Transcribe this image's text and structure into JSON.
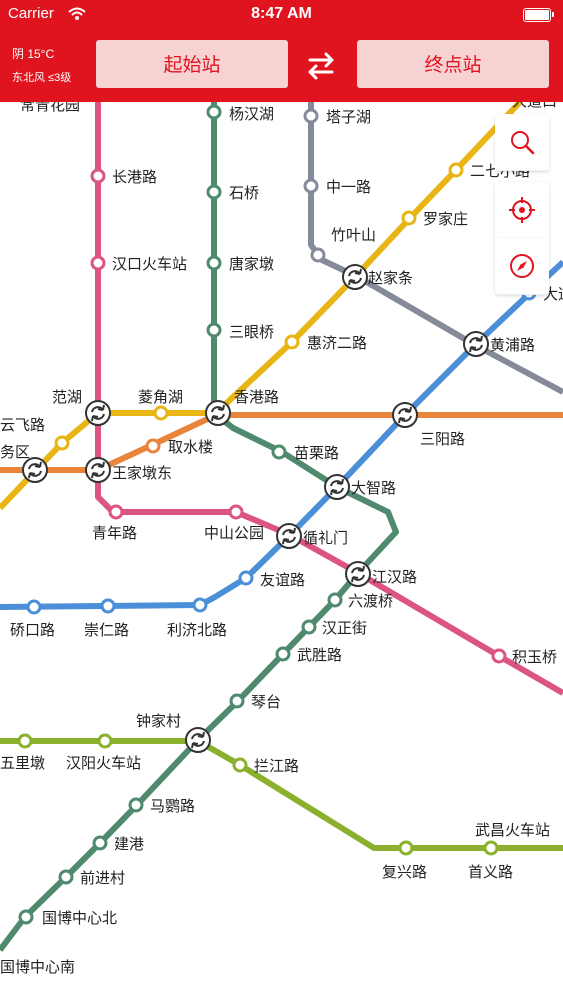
{
  "status": {
    "carrier": "Carrier",
    "time": "8:47 AM"
  },
  "toolbar": {
    "weather_line1": "阴 15°C",
    "weather_line2": "东北风 ≤3级",
    "start_label": "起始站",
    "end_label": "终点站"
  },
  "colors": {
    "brand": "#e0141f",
    "line1": "#4a8fd8",
    "line2": "#dc5481",
    "line3": "#e8b515",
    "line4": "#8ab02e",
    "line6": "#e9843b",
    "line7": "#4f8a6e",
    "line8": "#858b99"
  },
  "map": {
    "stations": {
      "changqing": "常青花园",
      "changgang": "长港路",
      "hankou_rs": "汉口火车站",
      "fanhu": "范湖",
      "wangjiadun": "王家墩东",
      "qingnian": "青年路",
      "zhongshan": "中山公园",
      "xunlimen": "循礼门",
      "jianghan": "江汉路",
      "jiyuqiao": "积玉桥",
      "yanghanhu": "杨汉湖",
      "shiqiao": "石桥",
      "tangjiadun": "唐家墩",
      "sanyanqiao": "三眼桥",
      "xianggang": "香港路",
      "miaoli": "苗栗路",
      "dazhi": "大智路",
      "liuduqiao": "六渡桥",
      "hanzheng": "汉正街",
      "wusheng": "武胜路",
      "qintai": "琴台",
      "zhongjiacun": "钟家村",
      "mayinglu": "马鹦路",
      "jiangang": "建港",
      "qianjin": "前进村",
      "guobo_n": "国博中心北",
      "guobo_s": "国博中心南",
      "tazihu": "塔子湖",
      "zhongyi": "中一路",
      "zhuyeshan": "竹叶山",
      "zhaojiatiao": "赵家条",
      "huangpu": "黄浦路",
      "luojiazhuang": "罗家庄",
      "erqi": "二七小路",
      "liudaokou": "大道口",
      "huiji2": "惠济二路",
      "sanyang": "三阳路",
      "lingjiaohu": "菱角湖",
      "yunfei": "云飞路",
      "wuqu": "务区",
      "qushuilou": "取水楼",
      "youyi": "友谊路",
      "qiaokou": "硚口路",
      "chongren": "崇仁路",
      "liji_n": "利济北路",
      "wulidun": "五里墩",
      "hanyang_rs": "汉阳火车站",
      "lanjiang": "拦江路",
      "fuxing": "复兴路",
      "shouyi": "首义路",
      "wuchang_rs": "武昌火车站",
      "dadao": "大道"
    }
  },
  "controls": {
    "search_icon": "search-icon",
    "locate_icon": "crosshair-icon",
    "compass_icon": "compass-icon"
  }
}
